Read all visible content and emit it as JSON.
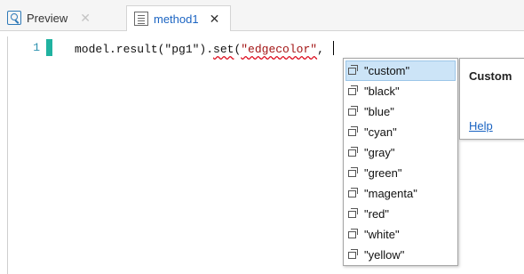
{
  "tabs": [
    {
      "label": "Preview",
      "icon": "preview-icon",
      "active": false,
      "close": "✕"
    },
    {
      "label": "method1",
      "icon": "method-icon",
      "active": true,
      "close": "✕"
    }
  ],
  "editor": {
    "line_number": "1",
    "code": {
      "part1": "model.result(\"pg1\").",
      "method": "set",
      "part2": "(",
      "string": "\"edgecolor\"",
      "part3": ", "
    }
  },
  "completion": {
    "items": [
      "\"custom\"",
      "\"black\"",
      "\"blue\"",
      "\"cyan\"",
      "\"gray\"",
      "\"green\"",
      "\"magenta\"",
      "\"red\"",
      "\"white\"",
      "\"yellow\""
    ],
    "selected_index": 0
  },
  "doc": {
    "title": "Custom",
    "help_link": "Help"
  },
  "colors": {
    "accent": "#1b64c2",
    "selection": "#cce4f7",
    "change_marker": "#20b2a0",
    "line_number": "#2b91af"
  }
}
